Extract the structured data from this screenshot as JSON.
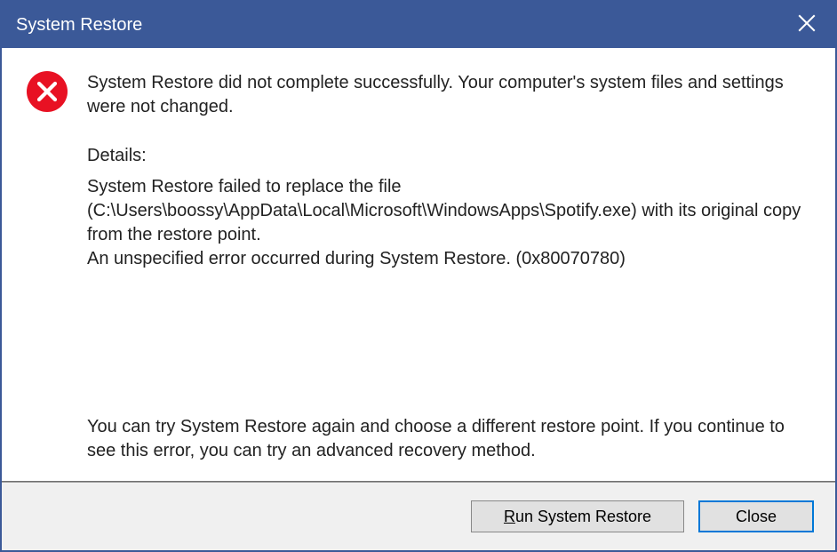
{
  "titlebar": {
    "title": "System Restore"
  },
  "message": {
    "summary": "System Restore did not complete successfully. Your computer's system files and settings were not changed.",
    "details_label": "Details:",
    "details_body": "System Restore failed to replace the file (C:\\Users\\boossy\\AppData\\Local\\Microsoft\\WindowsApps\\Spotify.exe) with its original copy from the restore point.\nAn unspecified error occurred during System Restore. (0x80070780)",
    "advice": "You can try System Restore again and choose a different restore point. If you continue to see this error, you can try an advanced recovery method."
  },
  "buttons": {
    "run_prefix": "R",
    "run_rest": "un System Restore",
    "close": "Close"
  },
  "colors": {
    "titlebar_bg": "#3b5998",
    "error_red": "#e81123",
    "focus_blue": "#0078d7"
  }
}
